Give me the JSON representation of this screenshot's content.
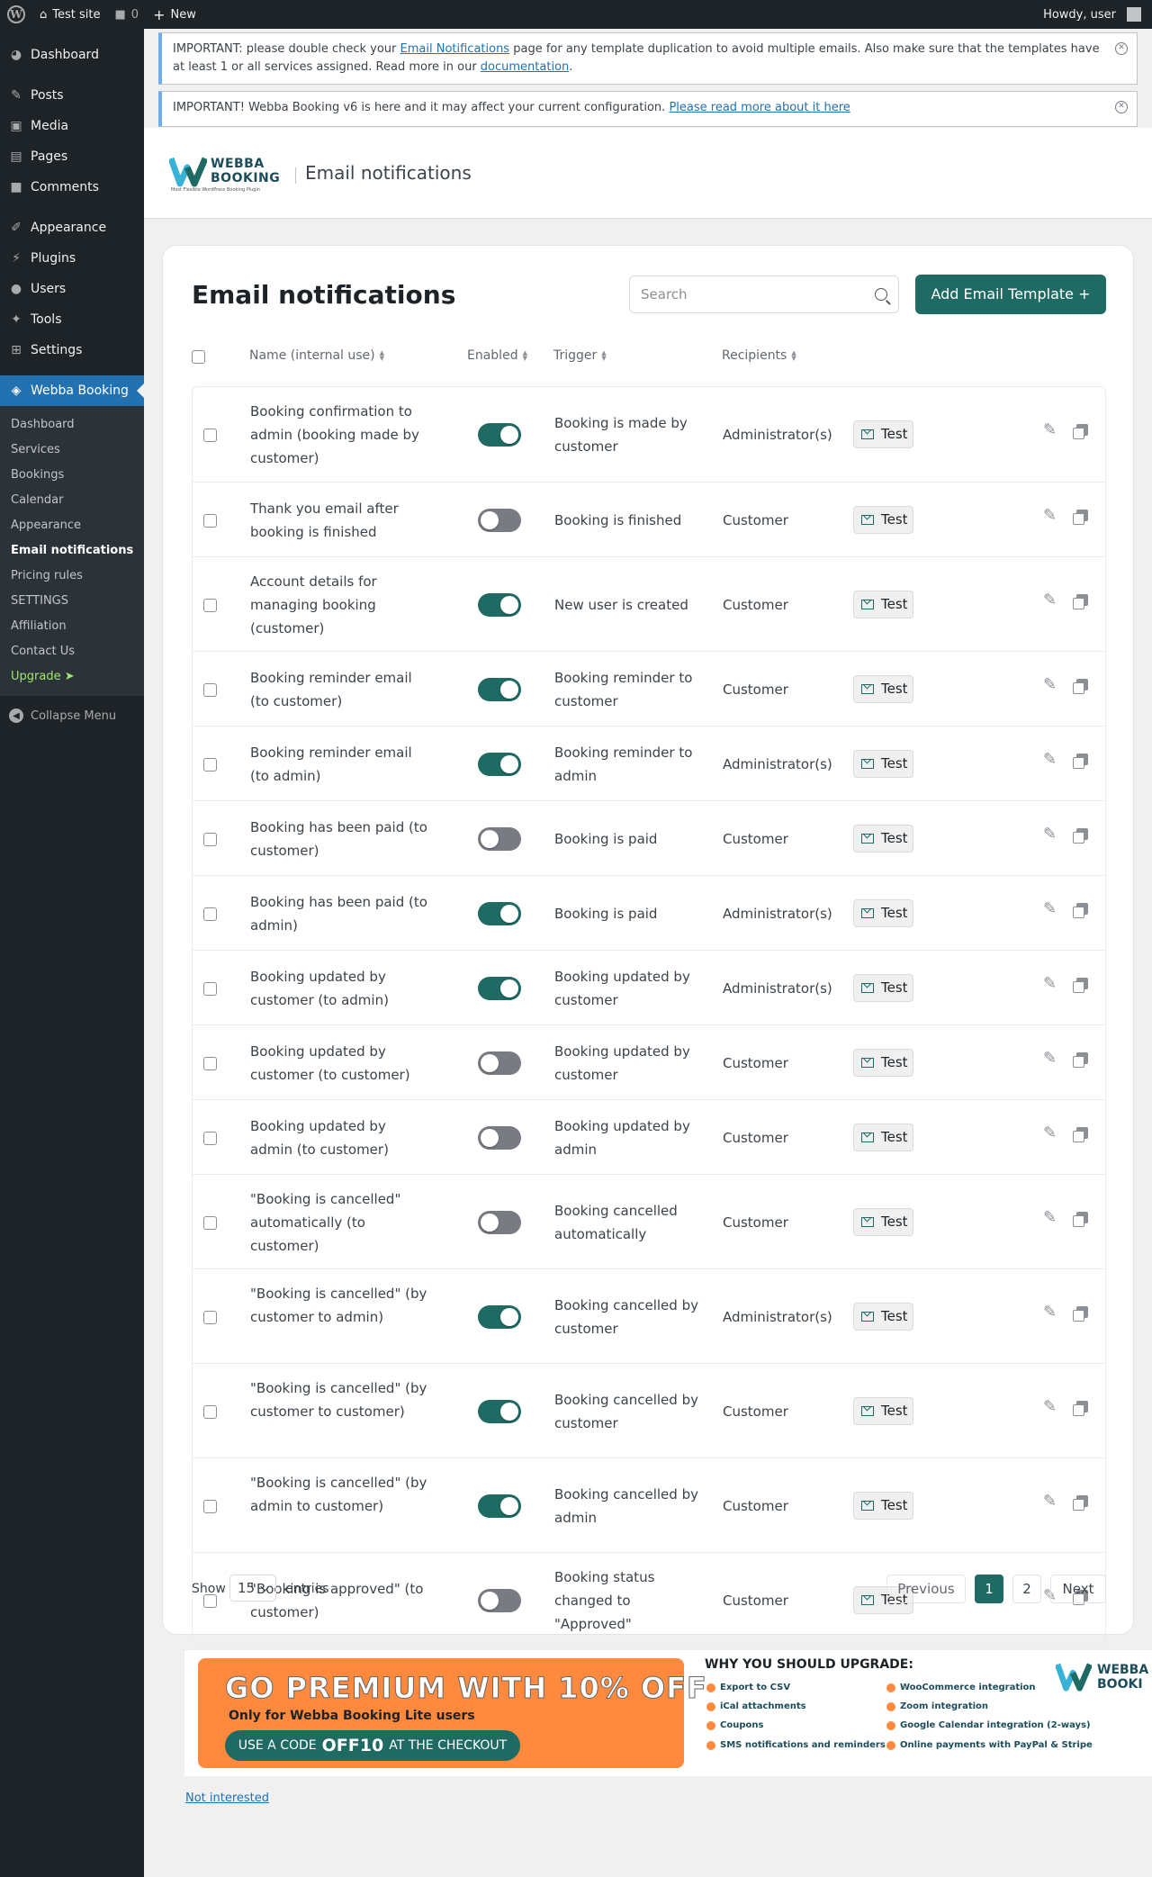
{
  "adminbar": {
    "site_name": "Test site",
    "comments_count": "0",
    "new_label": "New",
    "howdy": "Howdy, user"
  },
  "sidebar": {
    "items": [
      {
        "label": "Dashboard",
        "icon": "dashboard-icon"
      },
      {
        "label": "Posts",
        "icon": "pin-icon"
      },
      {
        "label": "Media",
        "icon": "media-icon"
      },
      {
        "label": "Pages",
        "icon": "pages-icon"
      },
      {
        "label": "Comments",
        "icon": "comment-icon"
      },
      {
        "label": "Appearance",
        "icon": "brush-icon"
      },
      {
        "label": "Plugins",
        "icon": "plugin-icon"
      },
      {
        "label": "Users",
        "icon": "user-icon"
      },
      {
        "label": "Tools",
        "icon": "wrench-icon"
      },
      {
        "label": "Settings",
        "icon": "settings-icon"
      },
      {
        "label": "Webba Booking",
        "icon": "webba-icon"
      }
    ],
    "submenu": [
      "Dashboard",
      "Services",
      "Bookings",
      "Calendar",
      "Appearance",
      "Email notifications",
      "Pricing rules",
      "SETTINGS",
      "Affiliation",
      "Contact Us",
      "Upgrade ➤"
    ],
    "collapse": "Collapse Menu"
  },
  "notices": {
    "n1_a": "IMPORTANT: please double check your ",
    "n1_link": "Email Notifications",
    "n1_b": " page for any template duplication to avoid multiple emails. Also make sure that the templates have at least 1 or all services assigned. Read more in our ",
    "n1_link2": "documentation",
    "n1_c": ".",
    "n2_a": "IMPORTANT! Webba Booking v6 is here and it may affect your current configuration. ",
    "n2_link": "Please read more about it here"
  },
  "header": {
    "logo_line1": "WEBBA",
    "logo_line2": "BOOKING",
    "logo_tag": "Most Flexible WordPress Booking Plugin",
    "title": "Email notifications"
  },
  "card": {
    "title": "Email notifications",
    "search_placeholder": "Search",
    "add_button": "Add Email Template +"
  },
  "columns": {
    "name": "Name (internal use)",
    "enabled": "Enabled",
    "trigger": "Trigger",
    "recipients": "Recipients"
  },
  "test_label": "Test",
  "rows": [
    {
      "name": "Booking confirmation to admin (booking made by customer)",
      "enabled": true,
      "trigger": "Booking is made by customer",
      "recipients": "Administrator(s)"
    },
    {
      "name": "Thank you email after booking is finished",
      "enabled": false,
      "trigger": "Booking is finished",
      "recipients": "Customer"
    },
    {
      "name": "Account details for managing booking (customer)",
      "enabled": true,
      "trigger": "New user is created",
      "recipients": "Customer"
    },
    {
      "name": "Booking reminder email (to customer)",
      "enabled": true,
      "trigger": "Booking reminder to customer",
      "recipients": "Customer"
    },
    {
      "name": "Booking reminder email (to admin)",
      "enabled": true,
      "trigger": "Booking reminder to admin",
      "recipients": "Administrator(s)"
    },
    {
      "name": "Booking has been paid (to customer)",
      "enabled": false,
      "trigger": "Booking is paid",
      "recipients": "Customer"
    },
    {
      "name": "Booking has been paid (to admin)",
      "enabled": true,
      "trigger": "Booking is paid",
      "recipients": "Administrator(s)"
    },
    {
      "name": "Booking updated by customer (to admin)",
      "enabled": true,
      "trigger": "Booking updated by customer",
      "recipients": "Administrator(s)"
    },
    {
      "name": "Booking updated by customer (to customer)",
      "enabled": false,
      "trigger": "Booking updated by customer",
      "recipients": "Customer"
    },
    {
      "name": "Booking updated by admin (to customer)",
      "enabled": false,
      "trigger": "Booking updated by admin",
      "recipients": "Customer"
    },
    {
      "name": "\"Booking is cancelled\" automatically (to customer)",
      "enabled": false,
      "trigger": "Booking cancelled automatically",
      "recipients": "Customer"
    },
    {
      "name": "\"Booking is cancelled\" (by customer to admin)",
      "enabled": true,
      "trigger": "Booking cancelled by customer",
      "recipients": "Administrator(s)"
    },
    {
      "name": "\"Booking is cancelled\" (by customer to customer)",
      "enabled": true,
      "trigger": "Booking cancelled by customer",
      "recipients": "Customer"
    },
    {
      "name": "\"Booking is cancelled\" (by admin to customer)",
      "enabled": true,
      "trigger": "Booking cancelled by admin",
      "recipients": "Customer"
    },
    {
      "name": "\"Booking is approved\" (to customer)",
      "enabled": false,
      "trigger": "Booking status changed to \"Approved\"",
      "recipients": "Customer"
    }
  ],
  "footer": {
    "show": "Show",
    "page_size": "15",
    "entries": "entries",
    "previous": "Previous",
    "page1": "1",
    "page2": "2",
    "next": "Next"
  },
  "promo": {
    "headline": "GO PREMIUM WITH 10% OFF",
    "sub": "Only for Webba Booking Lite users",
    "code_pre": "USE A CODE",
    "code": "OFF10",
    "code_post": "AT THE CHECKOUT",
    "why": "WHY YOU SHOULD UPGRADE:",
    "features": [
      "Export to CSV",
      "iCal attachments",
      "Coupons",
      "SMS notifications and reminders",
      "WooCommerce integration",
      "Zoom integration",
      "Google Calendar integration (2-ways)",
      "Online payments with PayPal & Stripe"
    ],
    "logo_line1": "WEBBA",
    "logo_line2": "BOOKI"
  },
  "not_interested": "Not interested",
  "colors": {
    "accent": "#1f6b64",
    "wp_blue": "#2271b1",
    "promo_orange": "#ff8a3d"
  }
}
